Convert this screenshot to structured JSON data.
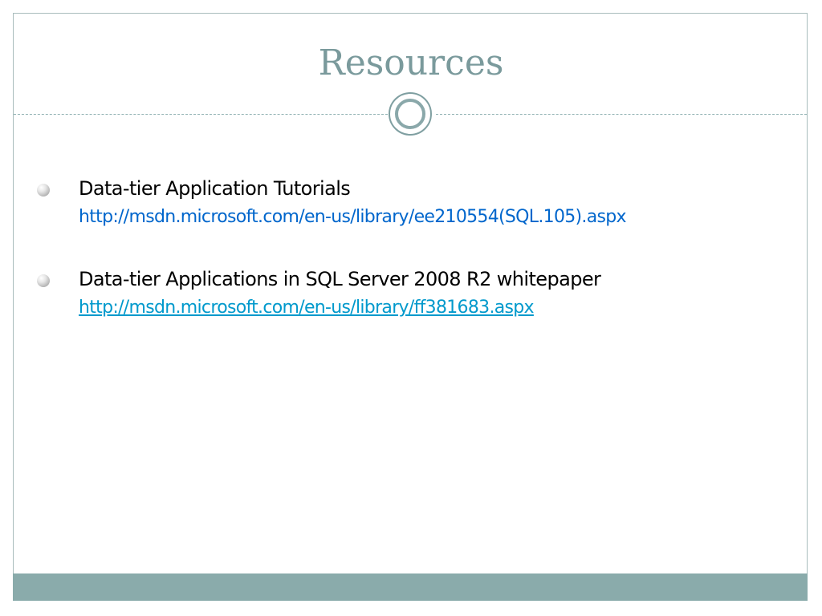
{
  "slide": {
    "title": "Resources"
  },
  "bullets": [
    {
      "text": "Data-tier Application Tutorials",
      "link": "http://msdn.microsoft.com/en-us/library/ee210554(SQL.105).aspx"
    },
    {
      "text": "Data-tier Applications in SQL Server 2008 R2 whitepaper",
      "link": "http://msdn.microsoft.com/en-us/library/ff381683.aspx"
    }
  ],
  "colors": {
    "title": "#7a9a9c",
    "link": "#0066cc",
    "link_underlined": "#0099cc",
    "footer_bar": "#8aabab",
    "frame_border": "#a9bdbd"
  },
  "icons": {
    "bullet": "sphere-bullet-icon",
    "ornament": "circle-ornament-icon"
  }
}
